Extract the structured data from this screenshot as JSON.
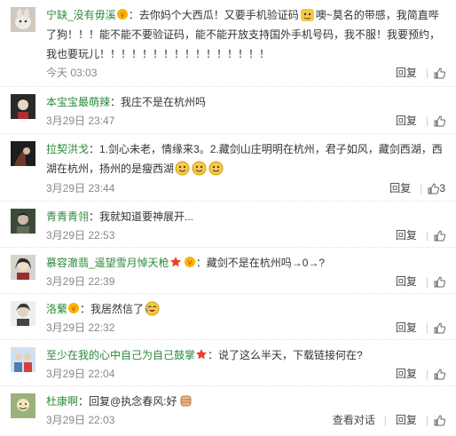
{
  "comments": [
    {
      "user": "宁缺_没有毋溪",
      "text_a": "：去你妈个大西瓜！又要手机验证码",
      "text_b": "噢~莫名的带感，我简直哔了狗！！！能不能不要验证码，能不能开放支持国外手机号码，我不服！我要预约，我也要玩儿！！！！！！！！！！！！！！！！",
      "time": "今天 03:03",
      "reply": "回复",
      "likes": ""
    },
    {
      "user": "本宝宝最萌辣",
      "text_a": "：我庄不是在杭州吗",
      "time": "3月29日 23:47",
      "reply": "回复",
      "likes": ""
    },
    {
      "user": "拉契洪戈",
      "text_a": "：1.剑心未老，情缘来3。2.藏剑山庄明明在杭州，君子如风，藏剑西湖，西湖在杭州，扬州的是瘦西湖",
      "time": "3月29日 23:44",
      "reply": "回复",
      "likes": "3"
    },
    {
      "user": "青青青翎",
      "text_a": "：我就知道要神展开...",
      "time": "3月29日 22:53",
      "reply": "回复",
      "likes": ""
    },
    {
      "user": "慕容澈翡_遥望雪月悼天枪",
      "text_a": "：藏剑不是在杭州吗→0→?",
      "time": "3月29日 22:39",
      "reply": "回复",
      "likes": ""
    },
    {
      "user": "洛蘩",
      "text_a": "：我居然信了",
      "time": "3月29日 22:32",
      "reply": "回复",
      "likes": ""
    },
    {
      "user": "至少在我的心中自己为自己鼓掌",
      "text_a": "：说了这么半天，下载链接何在?",
      "time": "3月29日 22:04",
      "reply": "回复",
      "likes": ""
    },
    {
      "user": "杜康啊",
      "text_a": "：回复@执念春风:好",
      "time": "3月29日 22:03",
      "view": "查看对话",
      "reply": "回复",
      "likes": ""
    }
  ],
  "colors": {
    "username": "#2c8a3a",
    "highlight_bg": "#f3f3f3"
  },
  "icons": [
    "thumb-up-icon",
    "vip-badge-icon",
    "star-badge-icon",
    "emoji-icon"
  ]
}
